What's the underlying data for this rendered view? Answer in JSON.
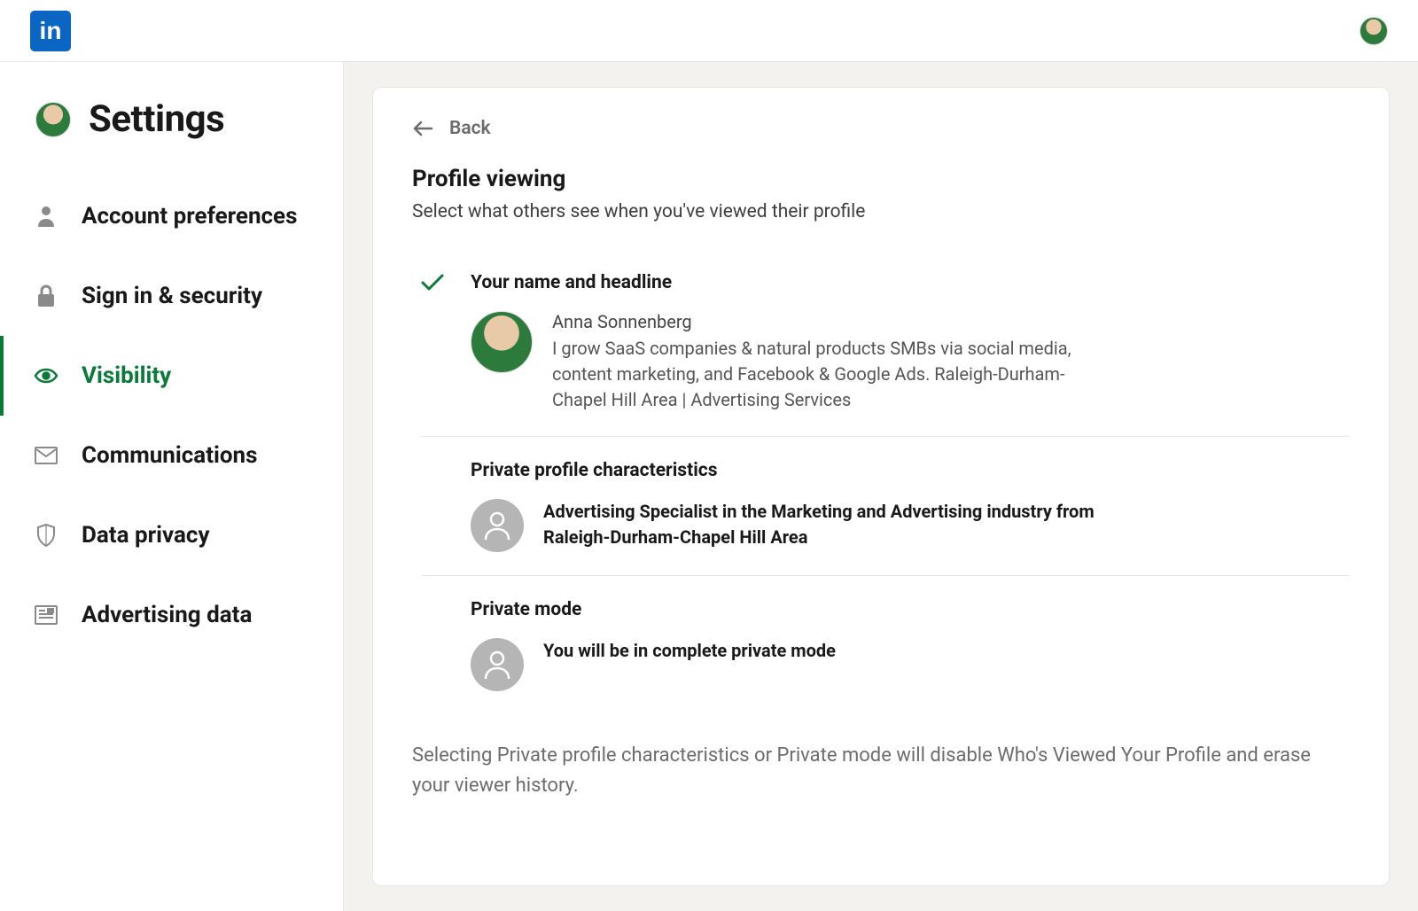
{
  "header": {
    "logo_text": "in"
  },
  "sidebar": {
    "title": "Settings",
    "items": [
      {
        "label": "Account preferences",
        "icon": "person"
      },
      {
        "label": "Sign in & security",
        "icon": "lock"
      },
      {
        "label": "Visibility",
        "icon": "eye",
        "active": true
      },
      {
        "label": "Communications",
        "icon": "mail"
      },
      {
        "label": "Data privacy",
        "icon": "shield"
      },
      {
        "label": "Advertising data",
        "icon": "ad"
      }
    ]
  },
  "main": {
    "back_label": "Back",
    "title": "Profile viewing",
    "subtitle": "Select what others see when you've viewed their profile",
    "options": [
      {
        "selected": true,
        "title": "Your name and headline",
        "profile_name": "Anna Sonnenberg",
        "profile_headline": "I grow SaaS companies & natural products SMBs via social media, content marketing, and Facebook & Google Ads. Raleigh-Durham-Chapel Hill Area | Advertising Services"
      },
      {
        "selected": false,
        "title": "Private profile characteristics",
        "description": "Advertising Specialist in the Marketing and Advertising industry from Raleigh-Durham-Chapel Hill Area"
      },
      {
        "selected": false,
        "title": "Private mode",
        "description": "You will be in complete private mode"
      }
    ],
    "note": "Selecting Private profile characteristics or Private mode will disable Who's Viewed Your Profile and erase your viewer history."
  },
  "colors": {
    "brand": "#0a66c2",
    "accent_green": "#0a7a3a"
  }
}
